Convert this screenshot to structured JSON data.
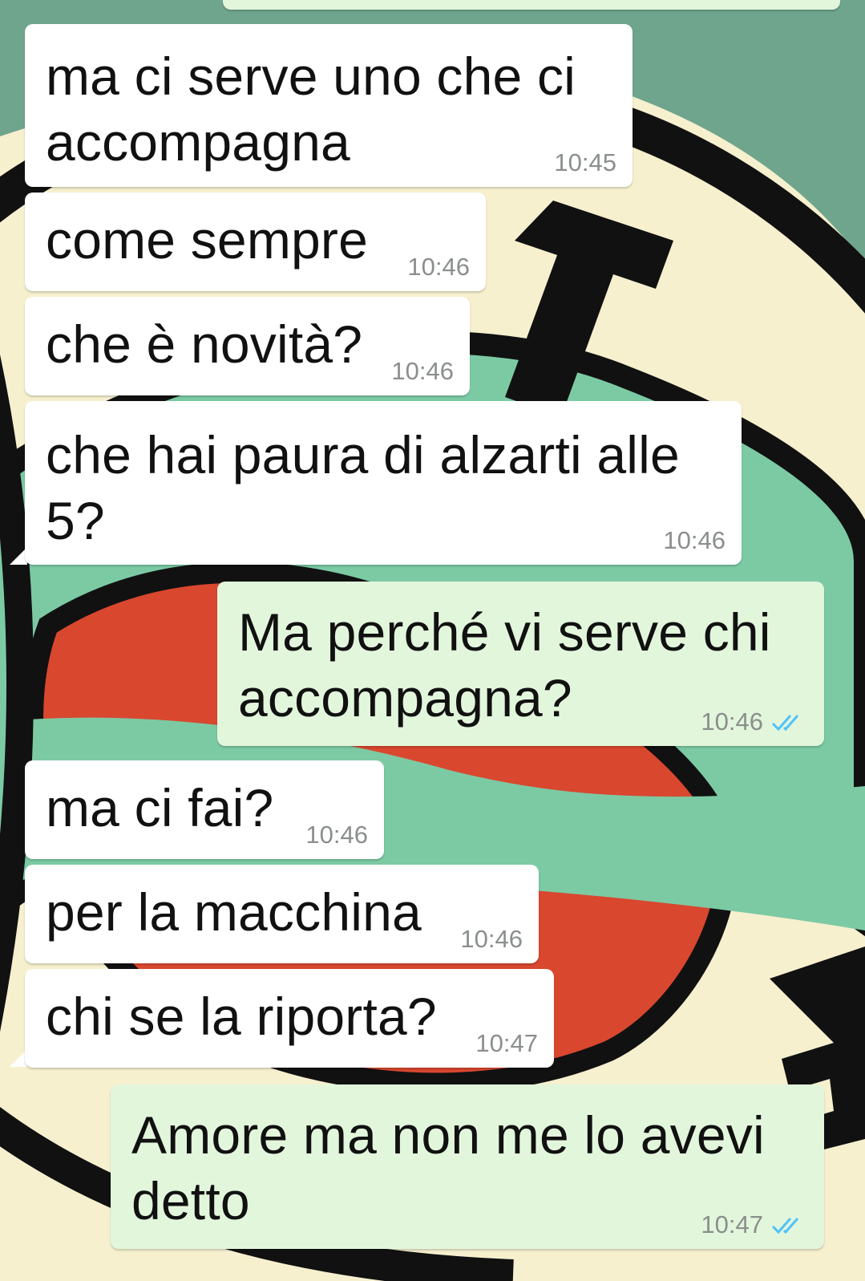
{
  "colors": {
    "incoming_bubble": "#ffffff",
    "outgoing_bubble": "#e2f6dc",
    "timestamp": "#8a8f8c",
    "read_ticks": "#4fc3f7",
    "wallpaper_green": "#7ccaa4",
    "wallpaper_red": "#d9472f",
    "wallpaper_cream": "#f6f0cf",
    "wallpaper_black": "#111111"
  },
  "chat": {
    "messages": [
      {
        "direction": "incoming",
        "text": "ma ci serve uno che ci\naccompagna",
        "time": "10:45"
      },
      {
        "direction": "incoming",
        "text": "come sempre",
        "time": "10:46"
      },
      {
        "direction": "incoming",
        "text": "che è novità?",
        "time": "10:46"
      },
      {
        "direction": "incoming",
        "text": "che hai paura di alzarti alle\n5?",
        "time": "10:46"
      },
      {
        "direction": "outgoing",
        "text": "Ma perché vi serve chi\naccompagna?",
        "time": "10:46",
        "status_icon": "double-check-icon"
      },
      {
        "direction": "incoming",
        "text": "ma ci fai?",
        "time": "10:46"
      },
      {
        "direction": "incoming",
        "text": "per la macchina",
        "time": "10:46"
      },
      {
        "direction": "incoming",
        "text": "chi se la riporta?",
        "time": "10:47"
      },
      {
        "direction": "outgoing",
        "text": "Amore ma non me lo avevi\ndetto",
        "time": "10:47",
        "status_icon": "double-check-icon"
      }
    ]
  }
}
